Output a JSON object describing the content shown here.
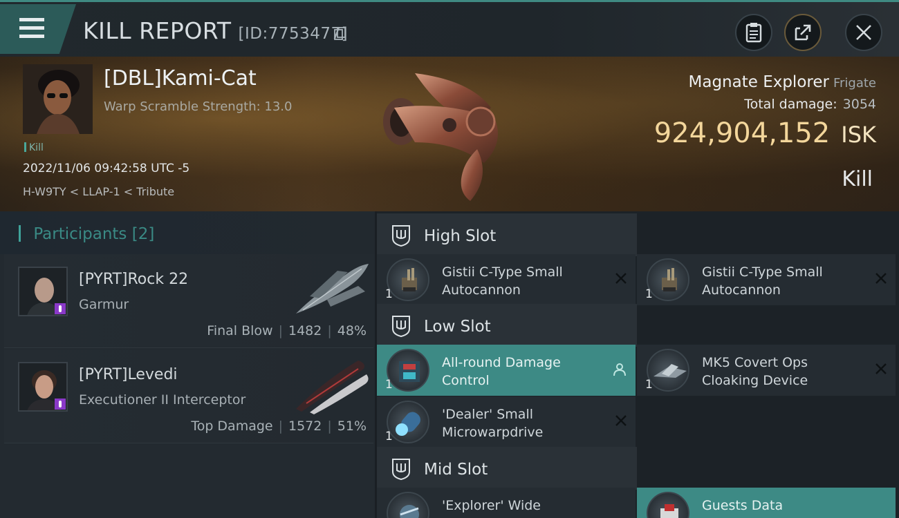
{
  "header": {
    "title": "KILL REPORT",
    "report_id": "[ID:7753477]"
  },
  "victim": {
    "name": "[DBL]Kami-Cat",
    "warp_scramble": "Warp Scramble Strength: 13.0",
    "tag": "Kill",
    "timestamp": "2022/11/06 09:42:58 UTC -5",
    "location": "H-W9TY < LLAP-1 < Tribute"
  },
  "ship": {
    "name": "Magnate Explorer",
    "class": "Frigate",
    "total_damage_label": "Total damage:",
    "total_damage": "3054",
    "isk_value": "924,904,152",
    "isk_unit": "ISK",
    "result": "Kill"
  },
  "participants": {
    "label": "Participants",
    "count": "[2]",
    "items": [
      {
        "name": "[PYRT]Rock 22",
        "ship": "Garmur",
        "role": "Final Blow",
        "damage": "1482",
        "percent": "48%"
      },
      {
        "name": "[PYRT]Levedi",
        "ship": "Executioner II Interceptor",
        "role": "Top Damage",
        "damage": "1572",
        "percent": "51%"
      }
    ]
  },
  "slots": {
    "high": {
      "label": "High Slot",
      "modules": [
        {
          "qty": "1",
          "name": "Gistii C-Type Small Autocannon"
        },
        {
          "qty": "1",
          "name": "Gistii C-Type Small Autocannon"
        }
      ]
    },
    "low": {
      "label": "Low Slot",
      "modules": [
        {
          "qty": "1",
          "name": "All-round Damage Control"
        },
        {
          "qty": "1",
          "name": "MK5 Covert Ops Cloaking Device"
        },
        {
          "qty": "1",
          "name": "'Dealer' Small Microwarpdrive"
        }
      ]
    },
    "mid": {
      "label": "Mid Slot",
      "modules": [
        {
          "qty": "",
          "name": "'Explorer' Wide"
        },
        {
          "qty": "",
          "name": "Guests Data"
        }
      ]
    }
  },
  "colors": {
    "accent": "#3d8a85",
    "isk_gold": "#f3d69b"
  }
}
